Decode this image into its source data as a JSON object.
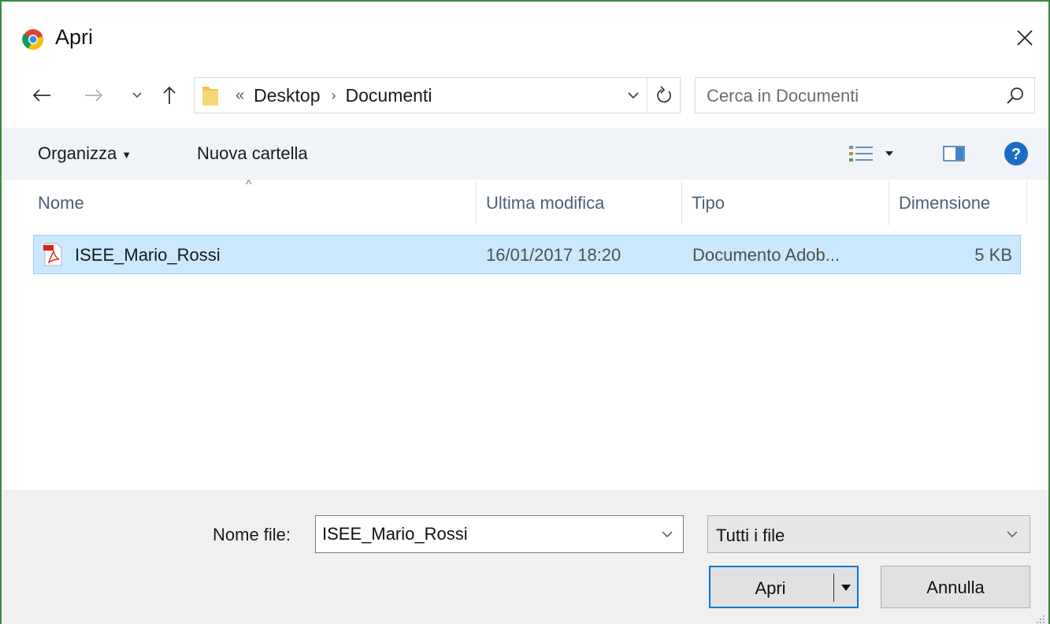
{
  "window": {
    "title": "Apri",
    "border_color": "#3c8a3c",
    "accent_color": "#0078d7",
    "selection_color": "#cce8ff"
  },
  "navigation": {
    "back_icon": "arrow-left-icon",
    "forward_icon": "arrow-right-icon",
    "recent_icon": "chevron-down-icon",
    "up_icon": "arrow-up-icon",
    "address": {
      "overflow_marker": "«",
      "breadcrumbs": [
        "Desktop",
        "Documenti"
      ]
    },
    "search": {
      "placeholder": "Cerca in Documenti",
      "value": ""
    }
  },
  "command_bar": {
    "organize_label": "Organizza",
    "new_folder_label": "Nuova cartella",
    "view_icon": "details-view-icon",
    "preview_icon": "preview-pane-icon",
    "help_icon": "help-icon"
  },
  "columns": [
    "Nome",
    "Ultima modifica",
    "Tipo",
    "Dimensione"
  ],
  "files": [
    {
      "icon": "pdf-file-icon",
      "name": "ISEE_Mario_Rossi",
      "modified": "16/01/2017 18:20",
      "type": "Documento Adob...",
      "size": "5 KB",
      "selected": true
    }
  ],
  "footer": {
    "filename_label": "Nome file:",
    "filename_value": "ISEE_Mario_Rossi",
    "filter_value": "Tutti i file",
    "open_label": "Apri",
    "cancel_label": "Annulla"
  }
}
